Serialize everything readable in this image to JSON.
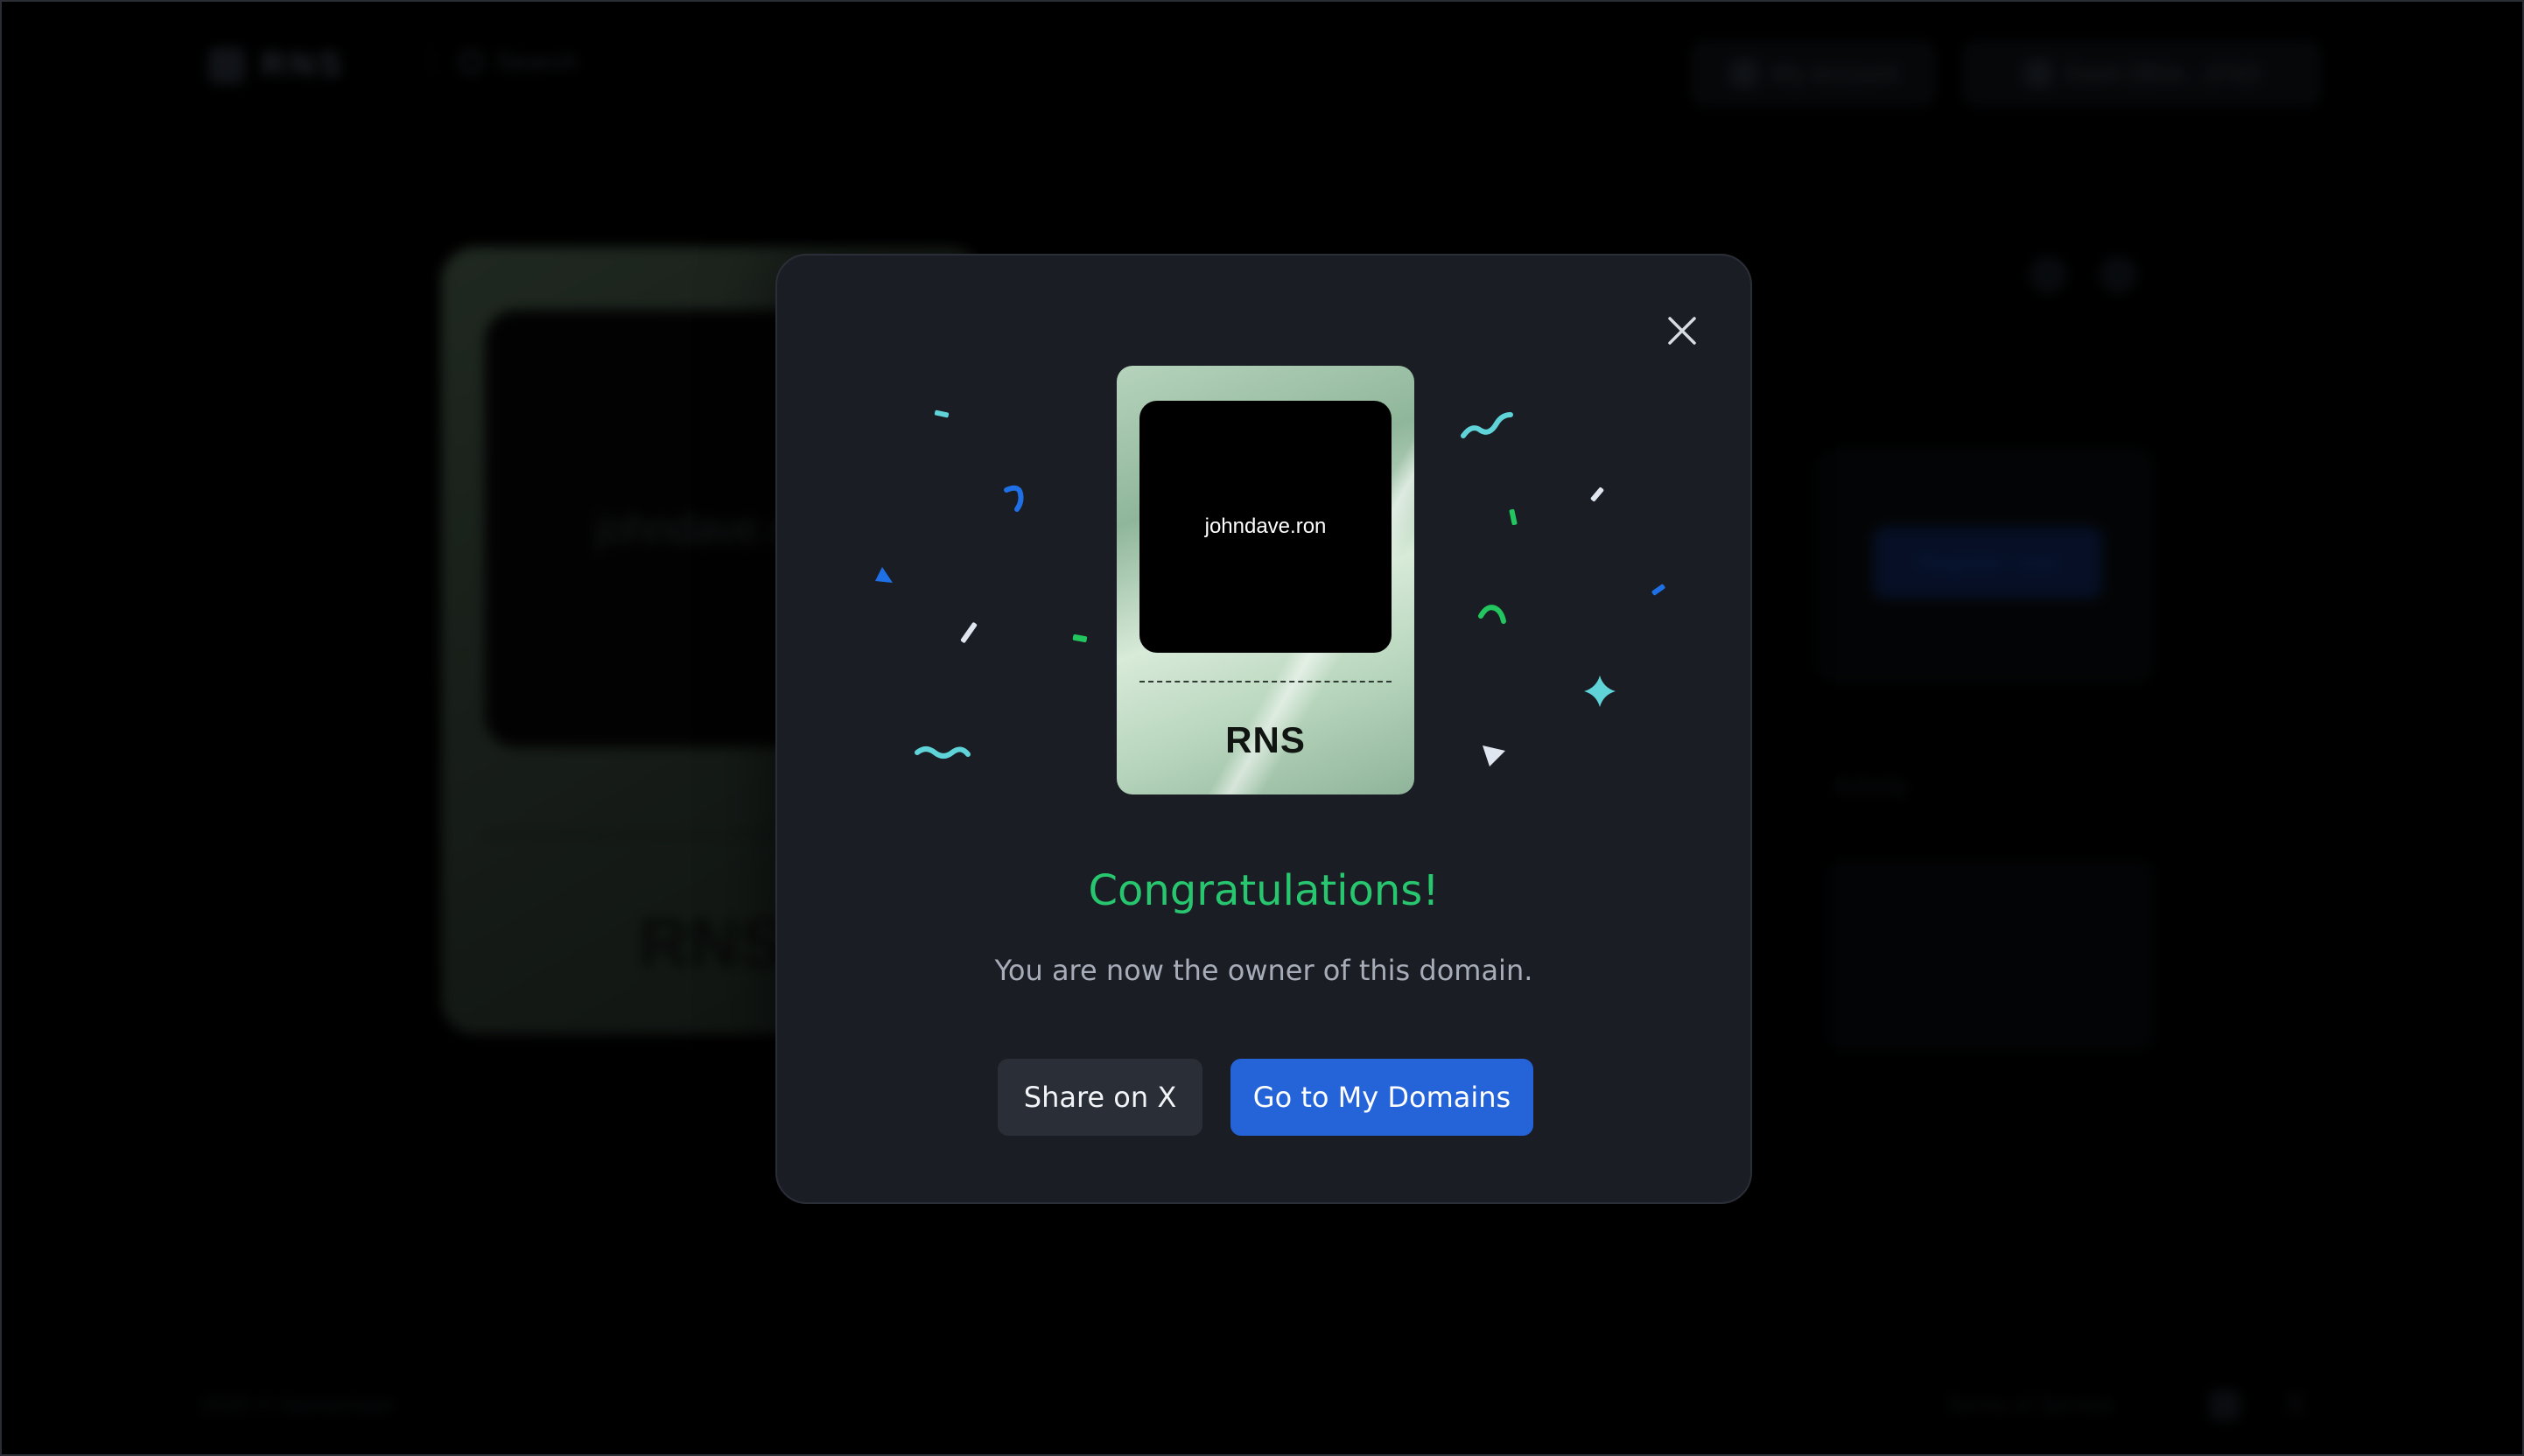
{
  "background": {
    "brand": "RNS",
    "search_placeholder": "Search",
    "account_label": "My account",
    "wallet_label": "0xeA 2B0e...1Fb3",
    "card_domain": "johndave.ron",
    "card_brand": "RNS",
    "register_label": "Register now",
    "activity_label": "Activity",
    "footer_copyright": "2025 © Namechain",
    "footer_terms": "Terms of Service",
    "footer_x": "X"
  },
  "modal": {
    "close_icon": "close-icon",
    "card": {
      "domain": "johndave.ron",
      "brand": "RNS"
    },
    "title": "Congratulations!",
    "subtitle": "You are now the owner of this domain.",
    "share_label": "Share on X",
    "primary_label": "Go to My Domains"
  },
  "colors": {
    "title_green": "#28c76f",
    "primary_blue": "#2563d9",
    "modal_bg": "#1a1d24",
    "confetti_cyan": "#5fd3d8",
    "confetti_blue": "#1f6fe6",
    "confetti_green": "#22c55e",
    "confetti_white": "#dfe6f0"
  }
}
